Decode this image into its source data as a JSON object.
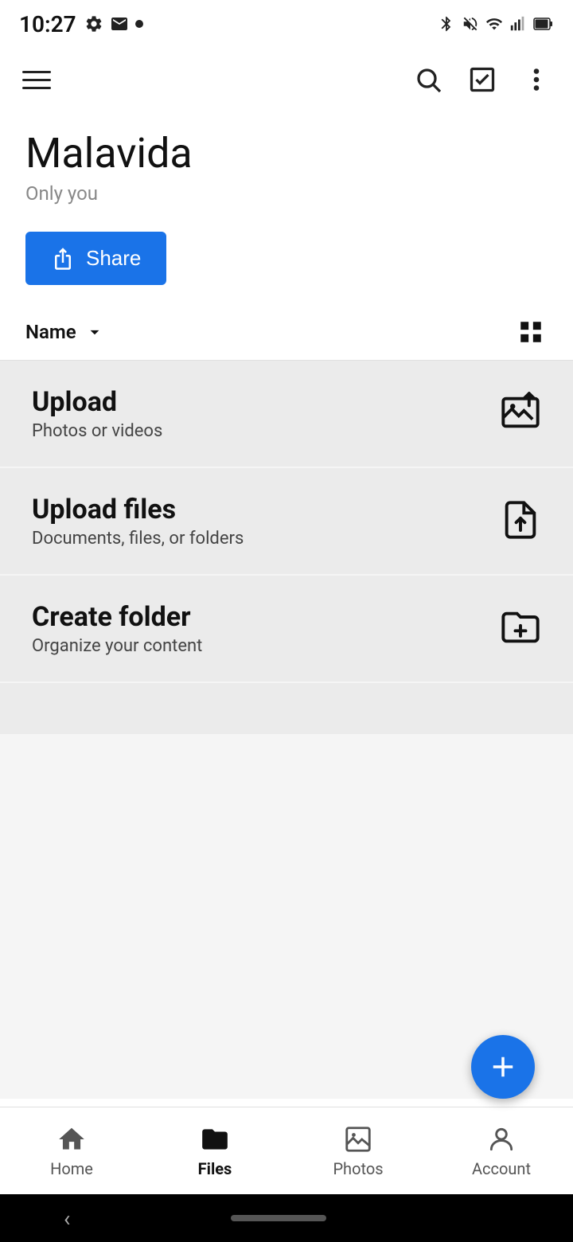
{
  "statusBar": {
    "time": "10:27",
    "leftIcons": [
      "settings-icon",
      "gmail-icon",
      "dot-icon"
    ],
    "rightIcons": [
      "bluetooth-icon",
      "mute-icon",
      "wifi-icon",
      "signal-icon",
      "battery-icon"
    ]
  },
  "appBar": {
    "menuLabel": "Menu",
    "searchLabel": "Search",
    "selectLabel": "Select",
    "moreLabel": "More options"
  },
  "header": {
    "title": "Malavida",
    "subtitle": "Only you"
  },
  "shareButton": {
    "label": "Share"
  },
  "sortBar": {
    "sortLabel": "Name",
    "sortDirection": "descending",
    "viewToggleLabel": "Grid view"
  },
  "actionCards": [
    {
      "title": "Upload",
      "subtitle": "Photos or videos",
      "iconName": "upload-photo-icon"
    },
    {
      "title": "Upload files",
      "subtitle": "Documents, files, or folders",
      "iconName": "upload-file-icon"
    },
    {
      "title": "Create folder",
      "subtitle": "Organize your content",
      "iconName": "create-folder-icon"
    }
  ],
  "fab": {
    "label": "Add"
  },
  "bottomNav": {
    "items": [
      {
        "label": "Home",
        "iconName": "home-icon",
        "active": false
      },
      {
        "label": "Files",
        "iconName": "files-icon",
        "active": true
      },
      {
        "label": "Photos",
        "iconName": "photos-icon",
        "active": false
      },
      {
        "label": "Account",
        "iconName": "account-icon",
        "active": false
      }
    ]
  }
}
